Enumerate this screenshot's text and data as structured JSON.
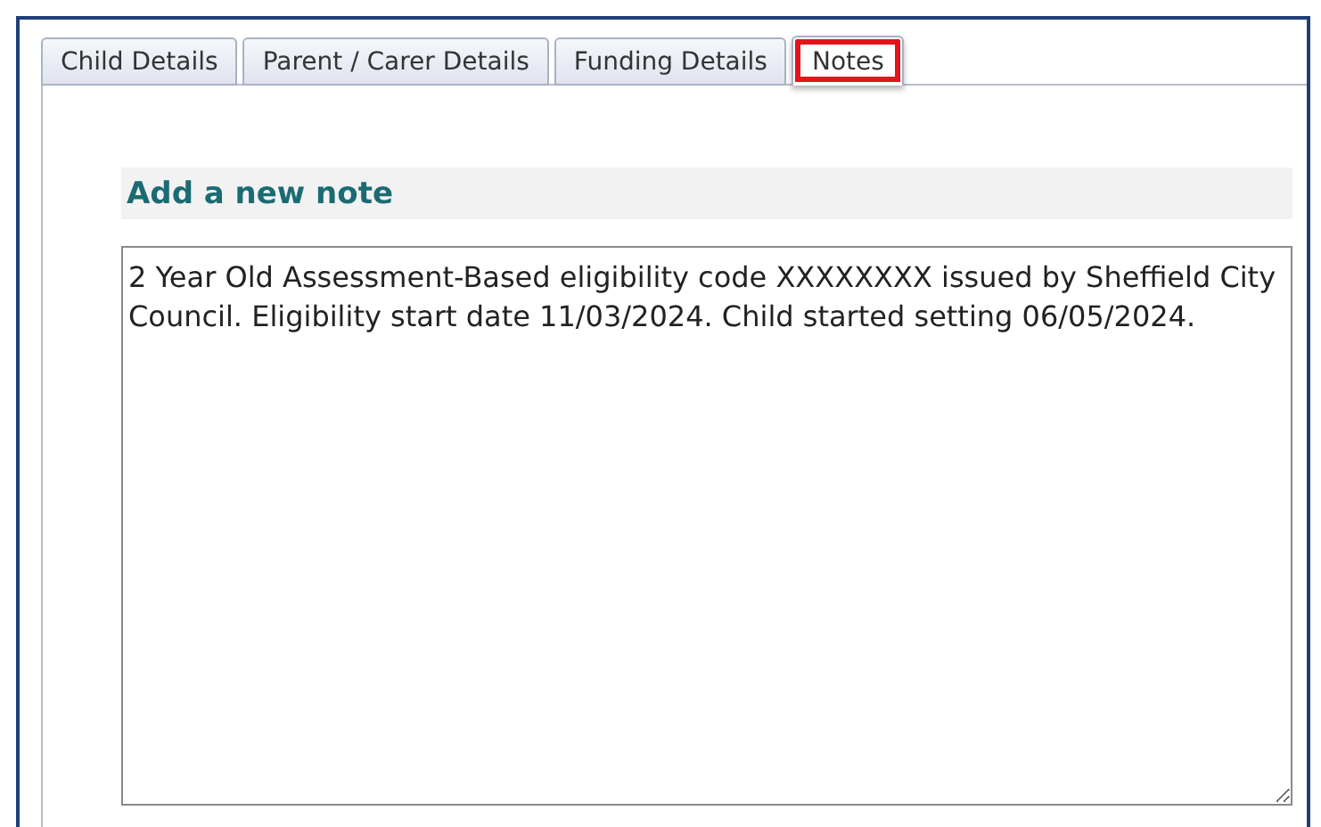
{
  "tabs": [
    {
      "label": "Child Details",
      "selected": false
    },
    {
      "label": "Parent / Carer Details",
      "selected": false
    },
    {
      "label": "Funding Details",
      "selected": false
    },
    {
      "label": "Notes",
      "selected": true
    }
  ],
  "section": {
    "title": "Add a new note"
  },
  "note": {
    "value": "2 Year Old Assessment-Based eligibility code XXXXXXXX issued by Sheffield City Council. Eligibility start date 11/03/2024. Child started setting 06/05/2024."
  }
}
